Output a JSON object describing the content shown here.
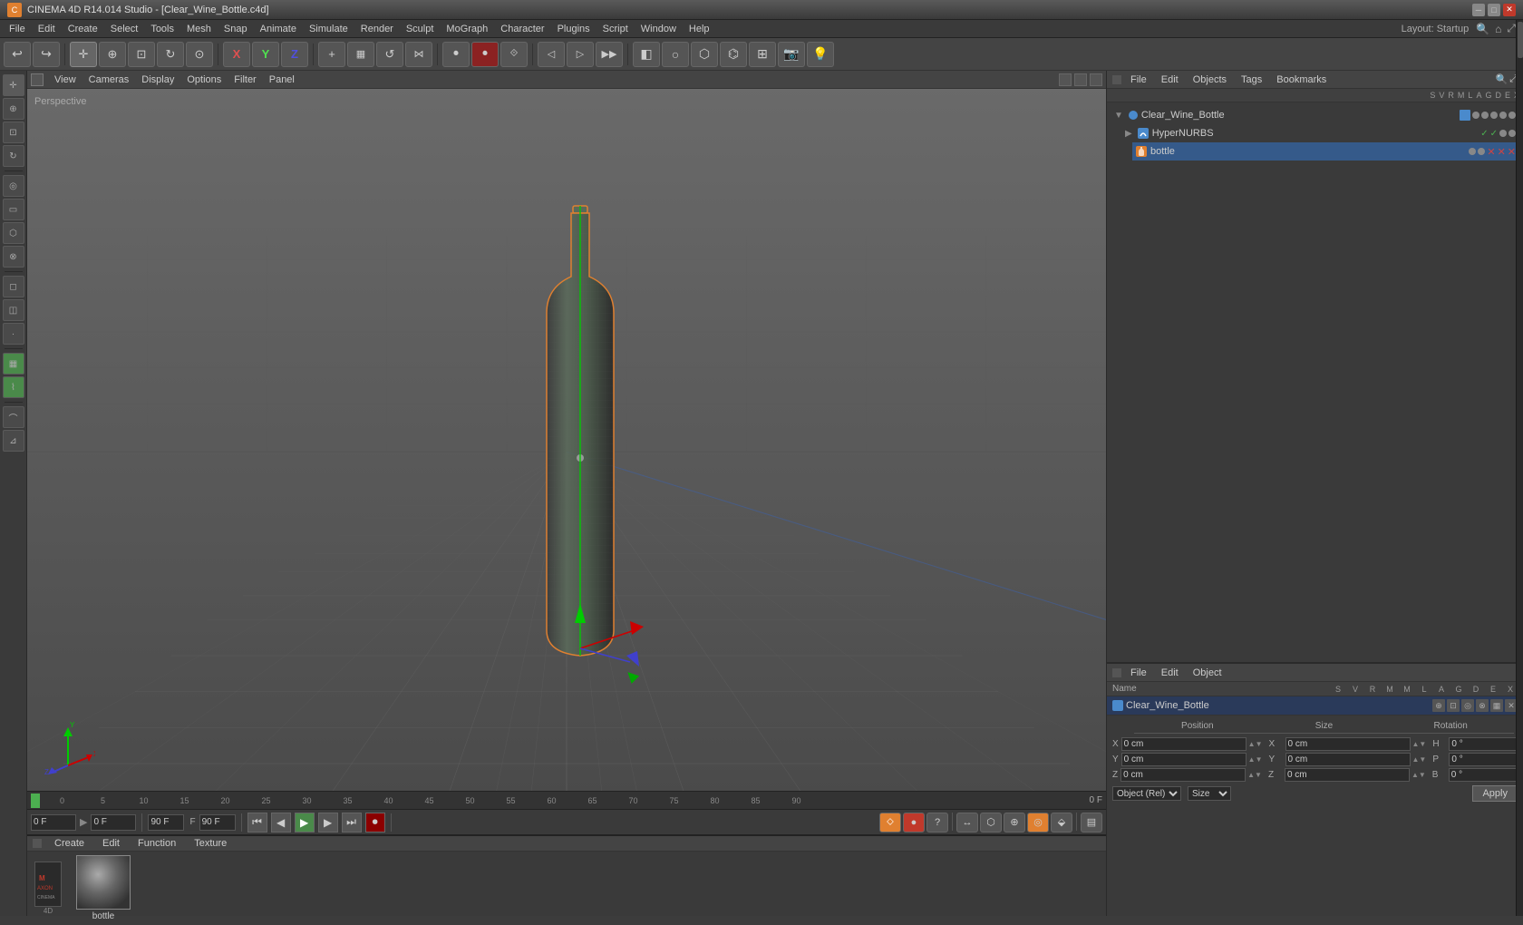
{
  "titlebar": {
    "title": "CINEMA 4D R14.014 Studio - [Clear_Wine_Bottle.c4d]",
    "layout_label": "Layout:",
    "layout_value": "Startup"
  },
  "menubar": {
    "items": [
      "File",
      "Edit",
      "Create",
      "Select",
      "Tools",
      "Mesh",
      "Snap",
      "Animate",
      "Simulate",
      "Render",
      "Sculpt",
      "MoGraph",
      "Character",
      "Plugins",
      "Script",
      "Window",
      "Help"
    ]
  },
  "toolbar": {
    "items": [
      "↩",
      "undo",
      "cursor",
      "move",
      "rotate",
      "scale",
      "join",
      "x",
      "y",
      "z",
      "plus",
      "rect",
      "freehand",
      "lasso",
      "anim_play",
      "anim_rec",
      "anim_keys",
      "anim_prev",
      "anim_next",
      "nurbs",
      "poly",
      "edge",
      "point",
      "live",
      "display",
      "filter",
      "grid",
      "camera",
      "render",
      "render_all",
      "render_region",
      "render_view",
      "ipr",
      "motion",
      "morph",
      "caps"
    ]
  },
  "left_toolbar": {
    "tools": [
      "cursor",
      "move",
      "scale",
      "rotate",
      "live",
      "mirror",
      "loop",
      "edge",
      "poly",
      "spline",
      "deform",
      "sculpt",
      "paint",
      "render",
      "cam",
      "grid",
      "snap",
      "axis"
    ]
  },
  "viewport": {
    "perspective_label": "Perspective",
    "view_menus": [
      "View",
      "Cameras",
      "Display",
      "Options",
      "Filter",
      "Panel"
    ],
    "icons_topright": [
      "expand",
      "grid",
      "layout"
    ]
  },
  "object_manager": {
    "menus": [
      "File",
      "Edit",
      "Objects",
      "Tags",
      "Bookmarks"
    ],
    "columns": [
      "S",
      "V",
      "R",
      "M",
      "L",
      "A",
      "G",
      "D",
      "E",
      "X"
    ],
    "objects": [
      {
        "name": "Clear_Wine_Bottle",
        "type": "null",
        "level": 0,
        "color": "blue",
        "selected": false
      },
      {
        "name": "HyperNURBS",
        "type": "nurbs",
        "level": 1,
        "color": "green",
        "selected": false
      },
      {
        "name": "bottle",
        "type": "bottle",
        "level": 2,
        "color": "orange",
        "selected": true
      }
    ]
  },
  "attribute_manager": {
    "menus": [
      "File",
      "Edit",
      "Object"
    ],
    "selected_name": "Clear_Wine_Bottle",
    "columns": {
      "s": "S",
      "v": "V",
      "r": "R",
      "m": "M",
      "l": "L",
      "a": "A",
      "g": "G",
      "d": "D",
      "e": "E",
      "x": "X"
    },
    "coord_section": {
      "position": {
        "label": "Position",
        "x": {
          "label": "X",
          "value": "0 cm"
        },
        "y": {
          "label": "Y",
          "value": "0 cm"
        },
        "z": {
          "label": "Z",
          "value": "0 cm"
        }
      },
      "size": {
        "label": "Size",
        "x": {
          "label": "X",
          "value": "0 cm"
        },
        "y": {
          "label": "Y",
          "value": "0 cm"
        },
        "z": {
          "label": "Z",
          "value": "0 cm"
        }
      },
      "rotation": {
        "label": "Rotation",
        "h": {
          "label": "H",
          "value": "0 °"
        },
        "p": {
          "label": "P",
          "value": "0 °"
        },
        "b": {
          "label": "B",
          "value": "0 °"
        }
      }
    },
    "dropdowns": {
      "coord_system": "Object (Rel)",
      "size_mode": "Size"
    },
    "apply_btn": "Apply"
  },
  "timeline": {
    "frames": [
      "0",
      "5",
      "10",
      "15",
      "20",
      "25",
      "30",
      "35",
      "40",
      "45",
      "50",
      "55",
      "60",
      "65",
      "70",
      "75",
      "80",
      "85",
      "90"
    ],
    "current_frame": "0 F",
    "end_frame": "90 F",
    "frame_display": "0 F"
  },
  "transport": {
    "current_frame_input": "0 F",
    "current_frame_input2": "0 F",
    "end_frame": "90 F",
    "end_frame2": "90 F",
    "fps_label": "F"
  },
  "material_editor": {
    "menus": [
      "Create",
      "Edit",
      "Function",
      "Texture"
    ],
    "materials": [
      {
        "name": "bottle",
        "type": "standard"
      }
    ]
  }
}
